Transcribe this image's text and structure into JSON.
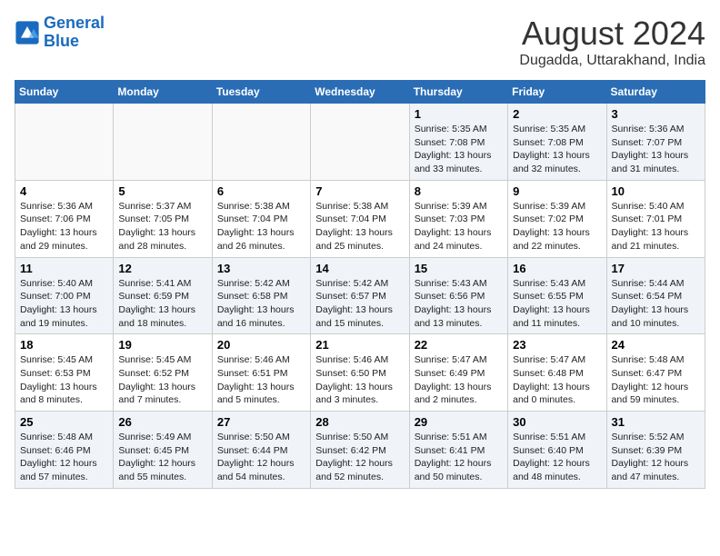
{
  "logo": {
    "line1": "General",
    "line2": "Blue"
  },
  "title": "August 2024",
  "subtitle": "Dugadda, Uttarakhand, India",
  "days_of_week": [
    "Sunday",
    "Monday",
    "Tuesday",
    "Wednesday",
    "Thursday",
    "Friday",
    "Saturday"
  ],
  "weeks": [
    {
      "days": [
        {
          "number": "",
          "info": ""
        },
        {
          "number": "",
          "info": ""
        },
        {
          "number": "",
          "info": ""
        },
        {
          "number": "",
          "info": ""
        },
        {
          "number": "1",
          "info": "Sunrise: 5:35 AM\nSunset: 7:08 PM\nDaylight: 13 hours\nand 33 minutes."
        },
        {
          "number": "2",
          "info": "Sunrise: 5:35 AM\nSunset: 7:08 PM\nDaylight: 13 hours\nand 32 minutes."
        },
        {
          "number": "3",
          "info": "Sunrise: 5:36 AM\nSunset: 7:07 PM\nDaylight: 13 hours\nand 31 minutes."
        }
      ]
    },
    {
      "days": [
        {
          "number": "4",
          "info": "Sunrise: 5:36 AM\nSunset: 7:06 PM\nDaylight: 13 hours\nand 29 minutes."
        },
        {
          "number": "5",
          "info": "Sunrise: 5:37 AM\nSunset: 7:05 PM\nDaylight: 13 hours\nand 28 minutes."
        },
        {
          "number": "6",
          "info": "Sunrise: 5:38 AM\nSunset: 7:04 PM\nDaylight: 13 hours\nand 26 minutes."
        },
        {
          "number": "7",
          "info": "Sunrise: 5:38 AM\nSunset: 7:04 PM\nDaylight: 13 hours\nand 25 minutes."
        },
        {
          "number": "8",
          "info": "Sunrise: 5:39 AM\nSunset: 7:03 PM\nDaylight: 13 hours\nand 24 minutes."
        },
        {
          "number": "9",
          "info": "Sunrise: 5:39 AM\nSunset: 7:02 PM\nDaylight: 13 hours\nand 22 minutes."
        },
        {
          "number": "10",
          "info": "Sunrise: 5:40 AM\nSunset: 7:01 PM\nDaylight: 13 hours\nand 21 minutes."
        }
      ]
    },
    {
      "days": [
        {
          "number": "11",
          "info": "Sunrise: 5:40 AM\nSunset: 7:00 PM\nDaylight: 13 hours\nand 19 minutes."
        },
        {
          "number": "12",
          "info": "Sunrise: 5:41 AM\nSunset: 6:59 PM\nDaylight: 13 hours\nand 18 minutes."
        },
        {
          "number": "13",
          "info": "Sunrise: 5:42 AM\nSunset: 6:58 PM\nDaylight: 13 hours\nand 16 minutes."
        },
        {
          "number": "14",
          "info": "Sunrise: 5:42 AM\nSunset: 6:57 PM\nDaylight: 13 hours\nand 15 minutes."
        },
        {
          "number": "15",
          "info": "Sunrise: 5:43 AM\nSunset: 6:56 PM\nDaylight: 13 hours\nand 13 minutes."
        },
        {
          "number": "16",
          "info": "Sunrise: 5:43 AM\nSunset: 6:55 PM\nDaylight: 13 hours\nand 11 minutes."
        },
        {
          "number": "17",
          "info": "Sunrise: 5:44 AM\nSunset: 6:54 PM\nDaylight: 13 hours\nand 10 minutes."
        }
      ]
    },
    {
      "days": [
        {
          "number": "18",
          "info": "Sunrise: 5:45 AM\nSunset: 6:53 PM\nDaylight: 13 hours\nand 8 minutes."
        },
        {
          "number": "19",
          "info": "Sunrise: 5:45 AM\nSunset: 6:52 PM\nDaylight: 13 hours\nand 7 minutes."
        },
        {
          "number": "20",
          "info": "Sunrise: 5:46 AM\nSunset: 6:51 PM\nDaylight: 13 hours\nand 5 minutes."
        },
        {
          "number": "21",
          "info": "Sunrise: 5:46 AM\nSunset: 6:50 PM\nDaylight: 13 hours\nand 3 minutes."
        },
        {
          "number": "22",
          "info": "Sunrise: 5:47 AM\nSunset: 6:49 PM\nDaylight: 13 hours\nand 2 minutes."
        },
        {
          "number": "23",
          "info": "Sunrise: 5:47 AM\nSunset: 6:48 PM\nDaylight: 13 hours\nand 0 minutes."
        },
        {
          "number": "24",
          "info": "Sunrise: 5:48 AM\nSunset: 6:47 PM\nDaylight: 12 hours\nand 59 minutes."
        }
      ]
    },
    {
      "days": [
        {
          "number": "25",
          "info": "Sunrise: 5:48 AM\nSunset: 6:46 PM\nDaylight: 12 hours\nand 57 minutes."
        },
        {
          "number": "26",
          "info": "Sunrise: 5:49 AM\nSunset: 6:45 PM\nDaylight: 12 hours\nand 55 minutes."
        },
        {
          "number": "27",
          "info": "Sunrise: 5:50 AM\nSunset: 6:44 PM\nDaylight: 12 hours\nand 54 minutes."
        },
        {
          "number": "28",
          "info": "Sunrise: 5:50 AM\nSunset: 6:42 PM\nDaylight: 12 hours\nand 52 minutes."
        },
        {
          "number": "29",
          "info": "Sunrise: 5:51 AM\nSunset: 6:41 PM\nDaylight: 12 hours\nand 50 minutes."
        },
        {
          "number": "30",
          "info": "Sunrise: 5:51 AM\nSunset: 6:40 PM\nDaylight: 12 hours\nand 48 minutes."
        },
        {
          "number": "31",
          "info": "Sunrise: 5:52 AM\nSunset: 6:39 PM\nDaylight: 12 hours\nand 47 minutes."
        }
      ]
    }
  ]
}
